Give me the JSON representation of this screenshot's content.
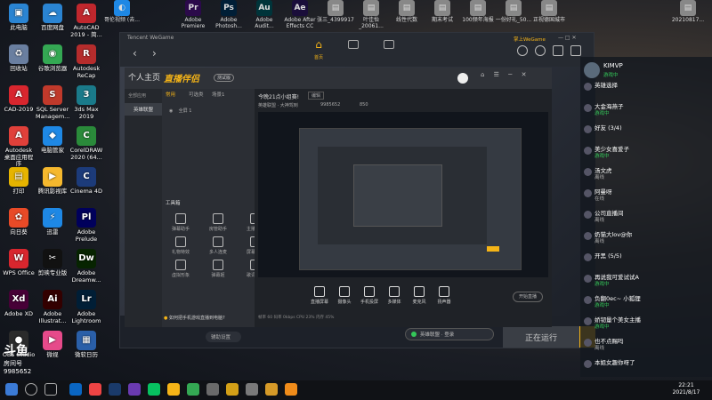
{
  "desktop_left": [
    {
      "label": "此电脑",
      "color": "#2a84d2",
      "glyph": "▣"
    },
    {
      "label": "回收站",
      "color": "#6a7fa0",
      "glyph": "♻"
    },
    {
      "label": "CAD-2019",
      "color": "#d8262e",
      "glyph": "A"
    },
    {
      "label": "Autodesk 桌面应用程序",
      "color": "#e0403a",
      "glyph": "A"
    },
    {
      "label": "打印",
      "color": "#e6b400",
      "glyph": "▤"
    },
    {
      "label": "向日葵",
      "color": "#e84a27",
      "glyph": "✿"
    },
    {
      "label": "WPS Office",
      "color": "#d8262e",
      "glyph": "W"
    },
    {
      "label": "Adobe XD",
      "color": "#470137",
      "glyph": "Xd"
    },
    {
      "label": "OBS Studio",
      "color": "#2b2b2b",
      "glyph": "●"
    }
  ],
  "desktop_left2": [
    {
      "label": "百度网盘",
      "color": "#2a84d2",
      "glyph": "☁"
    },
    {
      "label": "谷歌浏览器",
      "color": "#34a853",
      "glyph": "◉"
    },
    {
      "label": "SQL Server Managem...",
      "color": "#c0392b",
      "glyph": "S"
    },
    {
      "label": "电脑管家",
      "color": "#1e88e5",
      "glyph": "◆"
    },
    {
      "label": "腾讯影视库",
      "color": "#f5b82e",
      "glyph": "▶"
    },
    {
      "label": "迅雷",
      "color": "#1e88e5",
      "glyph": "⚡"
    },
    {
      "label": "剪映专业版",
      "color": "#111",
      "glyph": "✂"
    },
    {
      "label": "Adobe Illustrat...",
      "color": "#330000",
      "glyph": "Ai"
    },
    {
      "label": "微视",
      "color": "#e64a8a",
      "glyph": "▶"
    }
  ],
  "desktop_left3": [
    {
      "label": "AutoCAD 2019 - 简...",
      "color": "#c0272d",
      "glyph": "A"
    },
    {
      "label": "Autodesk ReCap",
      "color": "#b52c2c",
      "glyph": "R"
    },
    {
      "label": "3ds Max 2019",
      "color": "#1a7a8a",
      "glyph": "3"
    },
    {
      "label": "CorelDRAW 2020 (64...",
      "color": "#2a8a3a",
      "glyph": "C"
    },
    {
      "label": "Cinema 4D",
      "color": "#1c3b7a",
      "glyph": "C"
    },
    {
      "label": "Adobe Prelude",
      "color": "#00005b",
      "glyph": "Pl"
    },
    {
      "label": "Adobe Dreamw...",
      "color": "#072401",
      "glyph": "Dw"
    },
    {
      "label": "Adobe Lightroom",
      "color": "#001e36",
      "glyph": "Lr"
    },
    {
      "label": "微软日历",
      "color": "#2a5fa8",
      "glyph": "▦"
    }
  ],
  "desktop_top": [
    {
      "label": "哥伦视频 (去...",
      "color": "#1e88e5",
      "glyph": "◐"
    },
    {
      "label": "Adobe Premiere",
      "color": "#2b0a4a",
      "glyph": "Pr"
    },
    {
      "label": "Adobe Photosh...",
      "color": "#001e36",
      "glyph": "Ps"
    },
    {
      "label": "Adobe Audit...",
      "color": "#00343a",
      "glyph": "Au"
    },
    {
      "label": "Adobe After Effects CC",
      "color": "#1a0e3a",
      "glyph": "Ae"
    },
    {
      "label": "张三_4399917",
      "color": "#888",
      "glyph": "▤"
    },
    {
      "label": "叶佳怡_20061...",
      "color": "#888",
      "glyph": "▤"
    },
    {
      "label": "线性代数",
      "color": "#888",
      "glyph": "▤"
    },
    {
      "label": "期末考试",
      "color": "#888",
      "glyph": "▤"
    },
    {
      "label": "100频年海报",
      "color": "#888",
      "glyph": "▤"
    },
    {
      "label": "一份好礼_50...",
      "color": "#888",
      "glyph": "▤"
    },
    {
      "label": "正视德国城市",
      "color": "#888",
      "glyph": "▤"
    },
    {
      "label": "20210817...",
      "color": "#888",
      "glyph": "▤"
    }
  ],
  "wegame": {
    "title": "Tencent WeGame",
    "home_label": "首页",
    "user_label": "掌上WeGame",
    "nav": [
      "个人主页",
      "商店"
    ],
    "running_text": "正在运行",
    "assist_label": "辅助设置",
    "status_text": "英雄联盟 · 登录"
  },
  "zb": {
    "app_title": "直播伴侣",
    "version_badge": "测试版",
    "tabs": [
      "常用",
      "可选类",
      "场景1"
    ],
    "sidebar_label": "全部应用",
    "sidebar_item": "英雄联盟",
    "scene_item": "全屏 1",
    "tools_title": "工具箱",
    "tools": [
      "弹幕助手",
      "房管助手",
      "主播任务",
      "礼物特效",
      "多人连麦",
      "屏幕录像",
      "虚拟形象",
      "弹幕姬",
      "歌词显示"
    ],
    "title_bar": "今晚21点小组赛!",
    "title_edit": "编辑",
    "category": "英雄联盟 · 大神驾到",
    "room_id": "9985652",
    "viewers": "850",
    "bottom_buttons": [
      "直播屏幕",
      "摄像头",
      "手机投屏",
      "多媒体",
      "麦克风",
      "扬声器"
    ],
    "start_live": "开始直播",
    "tip": "如何把手机游戏直播到电脑?",
    "stats": "帧率 60  码率 0kbps  CPU 23%  内存 45%"
  },
  "chat": {
    "streamer": "KIMVP",
    "streamer_status": "游戏中",
    "messages": [
      {
        "name": "英雄选择",
        "sub": ""
      },
      {
        "name": "大金海燕子",
        "sub": "游戏中"
      },
      {
        "name": "好友 (3/4)",
        "sub": ""
      },
      {
        "name": "美少女喜爱子",
        "sub": "游戏中"
      },
      {
        "name": "汤文虎",
        "sub": "离线"
      },
      {
        "name": "阿曼呀",
        "sub": "在线"
      },
      {
        "name": "公司直播间",
        "sub": "离线"
      },
      {
        "name": "奶猫大lov@你",
        "sub": "离线"
      },
      {
        "name": "开黑 (5/5)",
        "sub": ""
      },
      {
        "name": "再说我可爱试试A",
        "sub": "游戏中"
      },
      {
        "name": "负翻0ec~ 小狐狸",
        "sub": "游戏中"
      },
      {
        "name": "娇韧量个美女主播",
        "sub": "游戏中"
      },
      {
        "name": "也不点赐吗",
        "sub": "离线"
      },
      {
        "name": "本姐女趣你呀了",
        "sub": ""
      }
    ]
  },
  "watermark": {
    "brand": "斗鱼",
    "room_label": "房间号",
    "room": "9985652"
  },
  "taskbar": {
    "time": "22:21",
    "date": "2021/8/17"
  },
  "colors": {
    "accent": "#f5b417",
    "bg": "#1d2129",
    "online": "#34c759"
  }
}
